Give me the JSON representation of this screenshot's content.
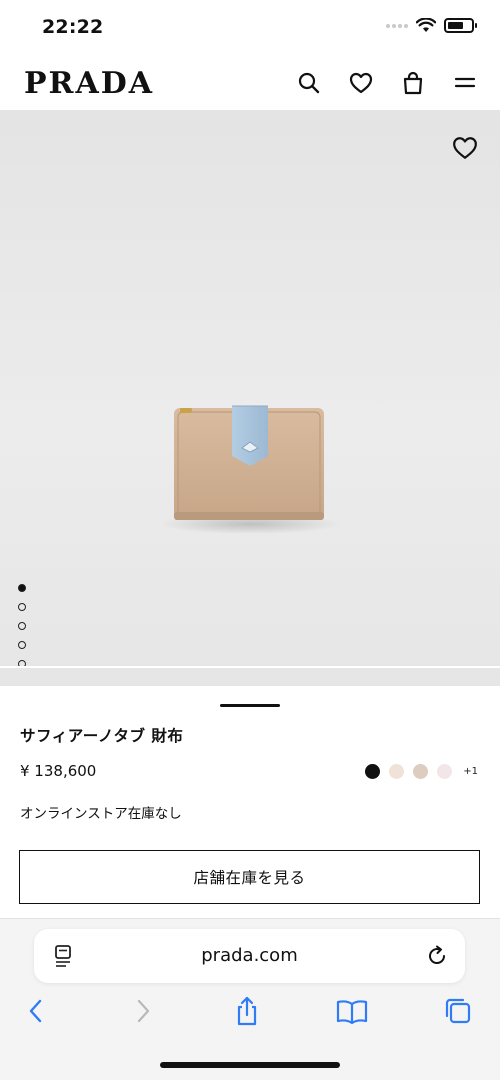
{
  "status_bar": {
    "time": "22:22",
    "battery_level": 0.7
  },
  "header": {
    "logo": "PRADA",
    "icons": [
      "search-icon",
      "heart-icon",
      "shopping-bag-icon",
      "menu-icon"
    ]
  },
  "gallery": {
    "favorite_icon": "heart-icon",
    "image_count": 5,
    "active_index": 0,
    "colors": {
      "background": "#e8e8e8",
      "wallet_body": "#d4b497",
      "wallet_tab": "#a9c4dc"
    }
  },
  "product": {
    "name": "サフィアーノタブ 財布",
    "price": "¥ 138,600",
    "swatches": [
      "#111111",
      "#efe3d9",
      "#ddccbf",
      "#f2e6e8"
    ],
    "more_colors": "+1",
    "stock_status": "オンラインストア在庫なし",
    "store_button": "店舗在庫を見る"
  },
  "browser": {
    "url": "prada.com",
    "accent": "#2f7cf6",
    "toolbar_icons": [
      "back-arrow-icon",
      "forward-arrow-icon",
      "share-icon",
      "bookmarks-icon",
      "tabs-icon"
    ]
  }
}
